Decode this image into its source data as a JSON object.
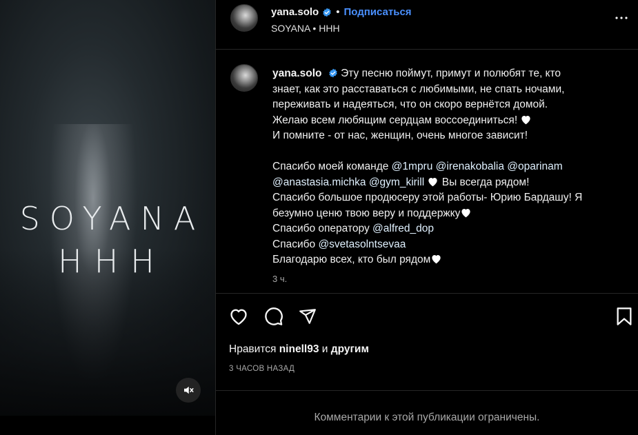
{
  "media": {
    "title_line1": "SOYANA",
    "title_line2": "HHH",
    "mute_icon": "speaker-muted-icon"
  },
  "post": {
    "username": "yana.solo",
    "separator": "•",
    "follow_label": "Подписаться",
    "subtitle": "SOYANA • HHH",
    "more_icon": "more-horizontal-icon"
  },
  "caption": {
    "username": "yana.solo",
    "lines": [
      "Эту песню поймут, примут и полюбят те, кто",
      "знает, как это расставаться с любимыми, не спать ночами,",
      "переживать и надеяться, что он скоро вернётся домой.",
      "Желаю всем любящим сердцам воссоединиться!",
      "И помните - от нас, женщин, очень многое зависит!",
      "Спасибо моей команде",
      "Вы всегда рядом!",
      "Спасибо большое продюсеру этой работы- Юрию Бардашу! Я",
      "безумно ценю твою веру и поддержку",
      "Спасибо оператору",
      "Спасибо",
      "Благодарю всех, кто был рядом"
    ],
    "mentions": [
      "@1mpru",
      "@irenakobalia",
      "@oparinam",
      "@anastasia.michka",
      "@gym_kirill",
      "@alfred_dop",
      "@svetasolntsevaa"
    ],
    "timestamp": "3 ч."
  },
  "actions": {
    "like_icon": "heart-icon",
    "comment_icon": "comment-icon",
    "share_icon": "send-icon",
    "save_icon": "bookmark-icon",
    "likes_prefix": "Нравится",
    "likes_user": "ninell93",
    "likes_and": "и",
    "likes_others": "другим",
    "posted_ago": "3 ЧАСОВ НАЗАД",
    "comments_restricted": "Комментарии к этой публикации ограничены."
  },
  "colors": {
    "background": "#000000",
    "accent_blue": "#4a90ff",
    "secondary_text": "#a8a8a8",
    "verified_badge": "#3897f0"
  }
}
